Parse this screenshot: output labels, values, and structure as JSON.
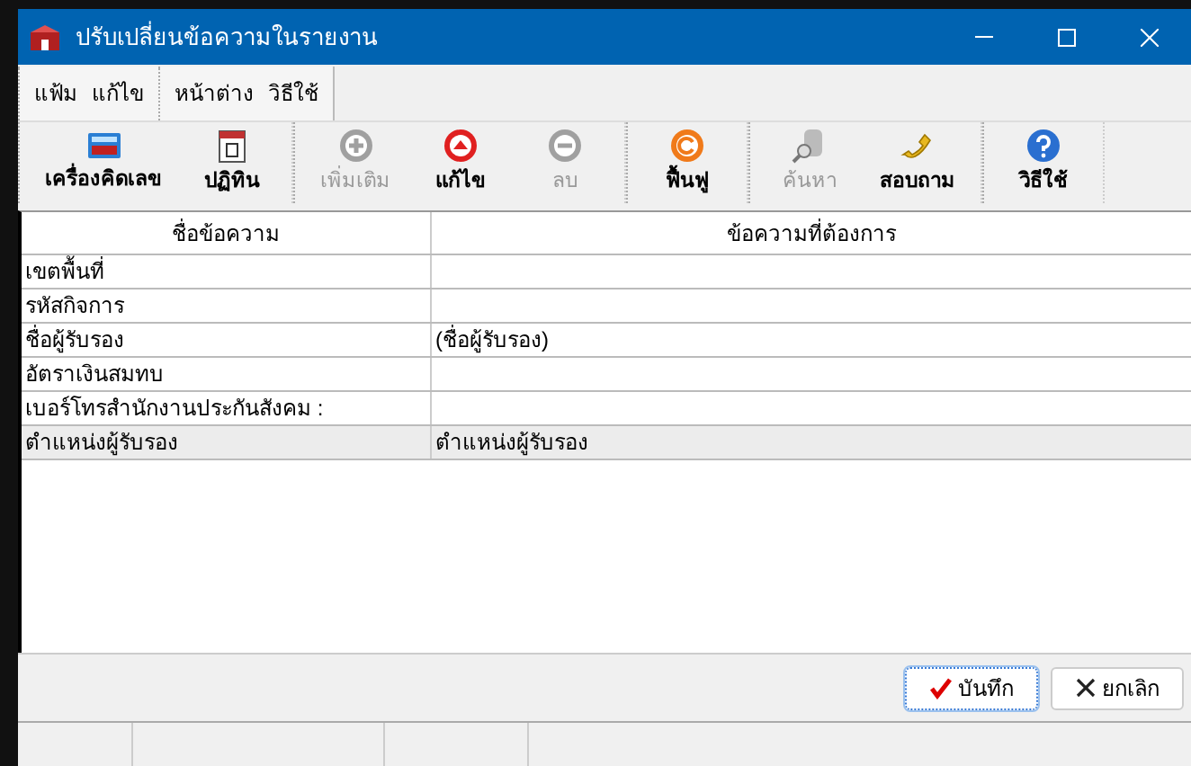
{
  "window": {
    "title": "ปรับเปลี่ยนข้อความในรายงาน"
  },
  "menu": [
    {
      "items": [
        "แฟ้ม",
        "แก้ไข"
      ]
    },
    {
      "items": [
        "หน้าต่าง",
        "วิธีใช้"
      ]
    }
  ],
  "toolbar": [
    {
      "items": [
        {
          "label": "เครื่องคิดเลข",
          "kind": "calculator",
          "disabled": false
        },
        {
          "label": "ปฏิทิน",
          "kind": "calendar",
          "disabled": false
        }
      ]
    },
    {
      "items": [
        {
          "label": "เพิ่มเติม",
          "kind": "add",
          "disabled": true
        },
        {
          "label": "แก้ไข",
          "kind": "edit",
          "disabled": false
        },
        {
          "label": "ลบ",
          "kind": "delete",
          "disabled": true
        }
      ]
    },
    {
      "items": [
        {
          "label": "ฟื้นฟู",
          "kind": "restore",
          "disabled": false
        }
      ]
    },
    {
      "items": [
        {
          "label": "ค้นหา",
          "kind": "search",
          "disabled": true
        },
        {
          "label": "สอบถาม",
          "kind": "phone",
          "disabled": false
        }
      ]
    },
    {
      "items": [
        {
          "label": "วิธีใช้",
          "kind": "help",
          "disabled": false
        }
      ]
    }
  ],
  "table": {
    "columns": [
      "ชื่อข้อความ",
      "ข้อความที่ต้องการ"
    ],
    "rows": [
      {
        "name": "เขตพื้นที่",
        "selected": false
      },
      {
        "name": "รหัสกิจการ",
        "selected": false
      },
      {
        "name": "ชื่อผู้รับรอง",
        "value": "(ชื่อผู้รับรอง)",
        "selected": false
      },
      {
        "name": "อัตราเงินสมทบ",
        "selected": false
      },
      {
        "name": "เบอร์โทรสำนักงานประกันสังคม :",
        "selected": false
      },
      {
        "name": "ตำแหน่งผู้รับรอง",
        "value": "ตำแหน่งผู้รับรอง",
        "selected": true
      }
    ]
  },
  "buttons": [
    {
      "label": "บันทึก",
      "kind": "save",
      "focused": true
    },
    {
      "label": "ยกเลิก",
      "kind": "cancel",
      "focused": false
    }
  ]
}
